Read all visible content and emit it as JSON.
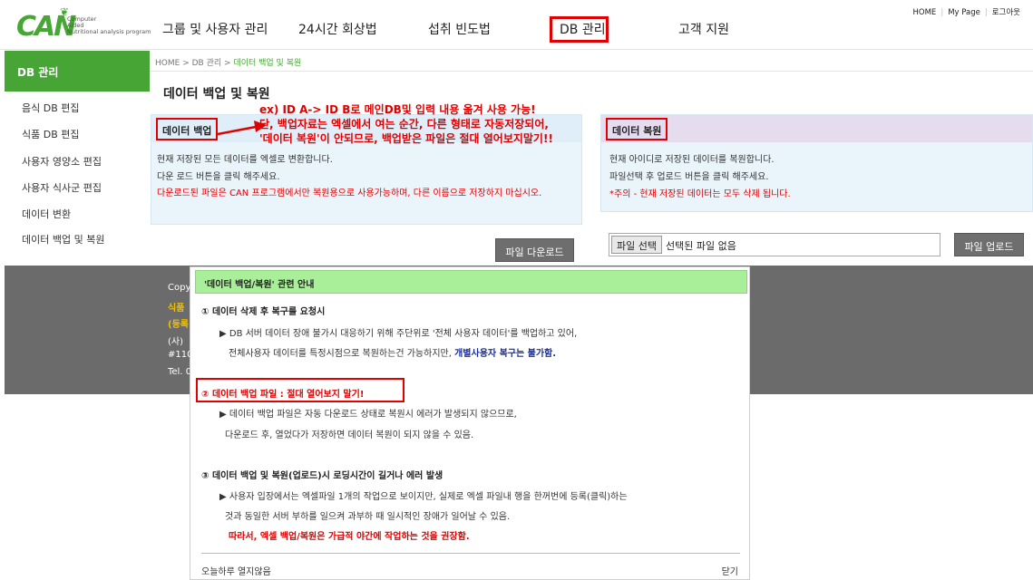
{
  "logo": {
    "mark": "CAN",
    "sub_line1": "Computer",
    "sub_line2": "Aided",
    "sub_line3": "Nutritional analysis program"
  },
  "gnb": {
    "items": [
      "그룹 및 사용자 관리",
      "24시간 회상법",
      "섭취 빈도법",
      "DB 관리",
      "고객 지원"
    ]
  },
  "util": {
    "home": "HOME",
    "mypage": "My Page",
    "logout": "로그아웃"
  },
  "sidebar": {
    "title": "DB 관리",
    "items": [
      "음식 DB 편집",
      "식품 DB 편집",
      "사용자 영양소 편집",
      "사용자 식사군 편집",
      "데이터 변환",
      "데이터 백업 및 복원"
    ]
  },
  "breadcrumb": {
    "home": "HOME",
    "sep": ">",
    "level1": "DB 관리",
    "current": "데이터 백업 및 복원"
  },
  "page_title": "데이터 백업 및 복원",
  "annotation": {
    "line1": "ex) ID A-> ID B로 메인DB및 입력 내용 옮겨 사용 가능!",
    "line2": "단, 백업자료는 엑셀에서 여는 순간, 다른 형태로 자동저장되어,",
    "line3": "'데이터 복원'이 안되므로, 백업받은 파일은 절대 열어보지말기!!"
  },
  "backup": {
    "label": "데이터 백업",
    "text1": "현재 저장된 모든 데이터를 엑셀로 변환합니다.",
    "text2": "다운 로드 버튼을 클릭 해주세요.",
    "warning": "다운로드된 파일은 CAN 프로그램에서만 복원용으로 사용가능하며, 다른 이름으로 저장하지 마십시오.",
    "button": "파일 다운로드"
  },
  "restore": {
    "label": "데이터 복원",
    "text1": "현재 아이디로 저장된 데이터를 복원합니다.",
    "text2": "파일선택 후 업로드 버튼을 클릭 해주세요.",
    "warning": "*주의 - 현재 저장된 데이터는 모두 삭제 됩니다.",
    "file_button": "파일 선택",
    "file_status": "선택된 파일 없음",
    "upload_button": "파일 업로드"
  },
  "footer": {
    "line1": "Copy",
    "line2": "식품",
    "line3": "(등록",
    "line4": "(사)",
    "line5": "#110",
    "line6": "Tel. 0"
  },
  "popup": {
    "title": "'데이터 백업/복원' 관련 안내",
    "s1_title": "① 데이터 삭제 후 복구를 요청시",
    "s1_line1": "▶ DB 서버 데이터 장애 불가시 대응하기 위해 주단위로 '전체 사용자 데이터'를 백업하고 있어,",
    "s1_line2": "전체사용자 데이터를 특정시점으로 복원하는건 가능하지만,",
    "s1_line2_blue": "개별사용자 복구는 불가함.",
    "s2_title": "② 데이터 백업 파일 : 절대 열어보지 말기!",
    "s2_line1": "▶ 데이터 백업 파일은 자동 다운로드 상태로 복원시 에러가 발생되지 않으므로,",
    "s2_line2": "다운로드 후, 열었다가 저장하면 데이터 복원이 되지 않을 수 있음.",
    "s3_title": "③ 데이터 백업 및 복원(업로드)시 로딩시간이 길거나 에러 발생",
    "s3_line1": "▶ 사용자 입장에서는 엑셀파일 1개의 작업으로 보이지만, 실제로 엑셀 파일내 행을 한꺼번에 등록(클릭)하는",
    "s3_line2": "것과 동일한 서버 부하를 일으켜 과부하 때 일시적인 장애가 일어날 수 있음.",
    "s3_red": "따라서, 엑셀 백업/복원은 가급적 야간에 작업하는 것을 권장함.",
    "dont_show": "오늘하루 열지않음",
    "close": "닫기"
  },
  "colors": {
    "accent_green": "#47a535",
    "alert_red": "#e00000",
    "popup_header": "#a9ef9a",
    "footer_gray": "#6b6b6b"
  }
}
